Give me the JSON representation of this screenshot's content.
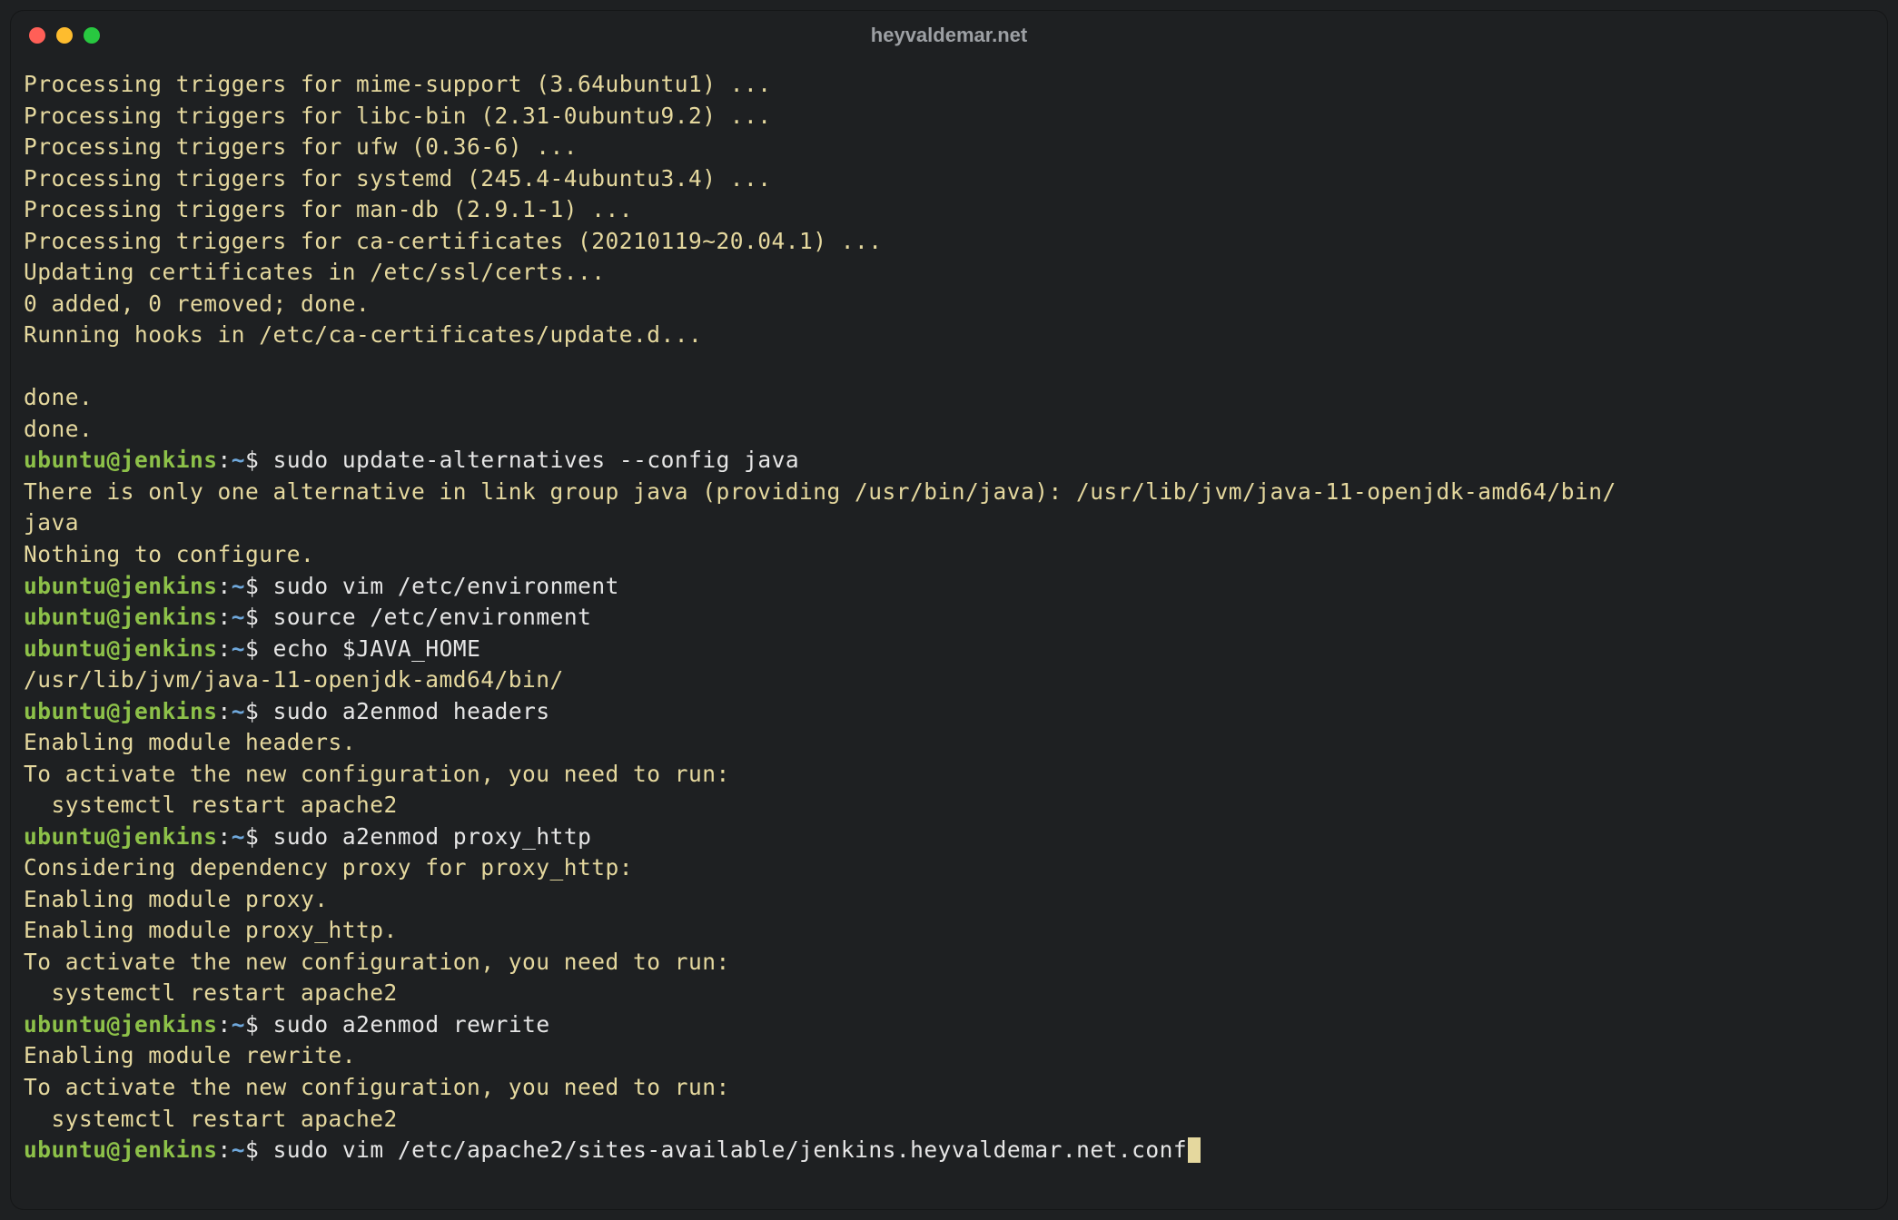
{
  "window": {
    "title": "heyvaldemar.net"
  },
  "prompt": {
    "user_host": "ubuntu@jenkins",
    "colon": ":",
    "path": "~",
    "dollar": "$"
  },
  "lines": [
    {
      "type": "out",
      "text": "Processing triggers for mime-support (3.64ubuntu1) ..."
    },
    {
      "type": "out",
      "text": "Processing triggers for libc-bin (2.31-0ubuntu9.2) ..."
    },
    {
      "type": "out",
      "text": "Processing triggers for ufw (0.36-6) ..."
    },
    {
      "type": "out",
      "text": "Processing triggers for systemd (245.4-4ubuntu3.4) ..."
    },
    {
      "type": "out",
      "text": "Processing triggers for man-db (2.9.1-1) ..."
    },
    {
      "type": "out",
      "text": "Processing triggers for ca-certificates (20210119~20.04.1) ..."
    },
    {
      "type": "out",
      "text": "Updating certificates in /etc/ssl/certs..."
    },
    {
      "type": "out",
      "text": "0 added, 0 removed; done."
    },
    {
      "type": "out",
      "text": "Running hooks in /etc/ca-certificates/update.d..."
    },
    {
      "type": "out",
      "text": ""
    },
    {
      "type": "out",
      "text": "done."
    },
    {
      "type": "out",
      "text": "done."
    },
    {
      "type": "cmd",
      "text": "sudo update-alternatives --config java"
    },
    {
      "type": "out",
      "text": "There is only one alternative in link group java (providing /usr/bin/java): /usr/lib/jvm/java-11-openjdk-amd64/bin/"
    },
    {
      "type": "out",
      "text": "java"
    },
    {
      "type": "out",
      "text": "Nothing to configure."
    },
    {
      "type": "cmd",
      "text": "sudo vim /etc/environment"
    },
    {
      "type": "cmd",
      "text": "source /etc/environment"
    },
    {
      "type": "cmd",
      "text": "echo $JAVA_HOME"
    },
    {
      "type": "out",
      "text": "/usr/lib/jvm/java-11-openjdk-amd64/bin/"
    },
    {
      "type": "cmd",
      "text": "sudo a2enmod headers"
    },
    {
      "type": "out",
      "text": "Enabling module headers."
    },
    {
      "type": "out",
      "text": "To activate the new configuration, you need to run:"
    },
    {
      "type": "out",
      "text": "  systemctl restart apache2"
    },
    {
      "type": "cmd",
      "text": "sudo a2enmod proxy_http"
    },
    {
      "type": "out",
      "text": "Considering dependency proxy for proxy_http:"
    },
    {
      "type": "out",
      "text": "Enabling module proxy."
    },
    {
      "type": "out",
      "text": "Enabling module proxy_http."
    },
    {
      "type": "out",
      "text": "To activate the new configuration, you need to run:"
    },
    {
      "type": "out",
      "text": "  systemctl restart apache2"
    },
    {
      "type": "cmd",
      "text": "sudo a2enmod rewrite"
    },
    {
      "type": "out",
      "text": "Enabling module rewrite."
    },
    {
      "type": "out",
      "text": "To activate the new configuration, you need to run:"
    },
    {
      "type": "out",
      "text": "  systemctl restart apache2"
    },
    {
      "type": "cmd",
      "text": "sudo vim /etc/apache2/sites-available/jenkins.heyvaldemar.net.conf",
      "cursor": true
    }
  ]
}
